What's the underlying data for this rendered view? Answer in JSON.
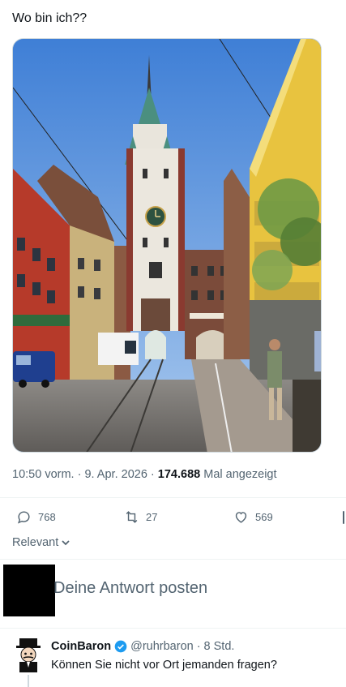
{
  "post": {
    "text": "Wo bin ich??",
    "image_alt_icon": "street-photo",
    "meta": {
      "time": "10:50 vorm.",
      "separator": "·",
      "date": "9. Apr. 2026",
      "views_count": "174.688",
      "views_label": "Mal angezeigt"
    },
    "actions": {
      "replies": "768",
      "reposts": "27",
      "likes": "569"
    }
  },
  "sort": {
    "label": "Relevant"
  },
  "reply_box": {
    "placeholder": "Deine Antwort posten"
  },
  "comment": {
    "name": "CoinBaron",
    "handle": "@ruhrbaron",
    "separator": "·",
    "age": "8 Std.",
    "text": "Können Sie nicht vor Ort jemanden fragen?"
  },
  "colors": {
    "text": "#0f1419",
    "muted": "#536471",
    "divider": "#eff3f4",
    "verified": "#1d9bf0"
  }
}
